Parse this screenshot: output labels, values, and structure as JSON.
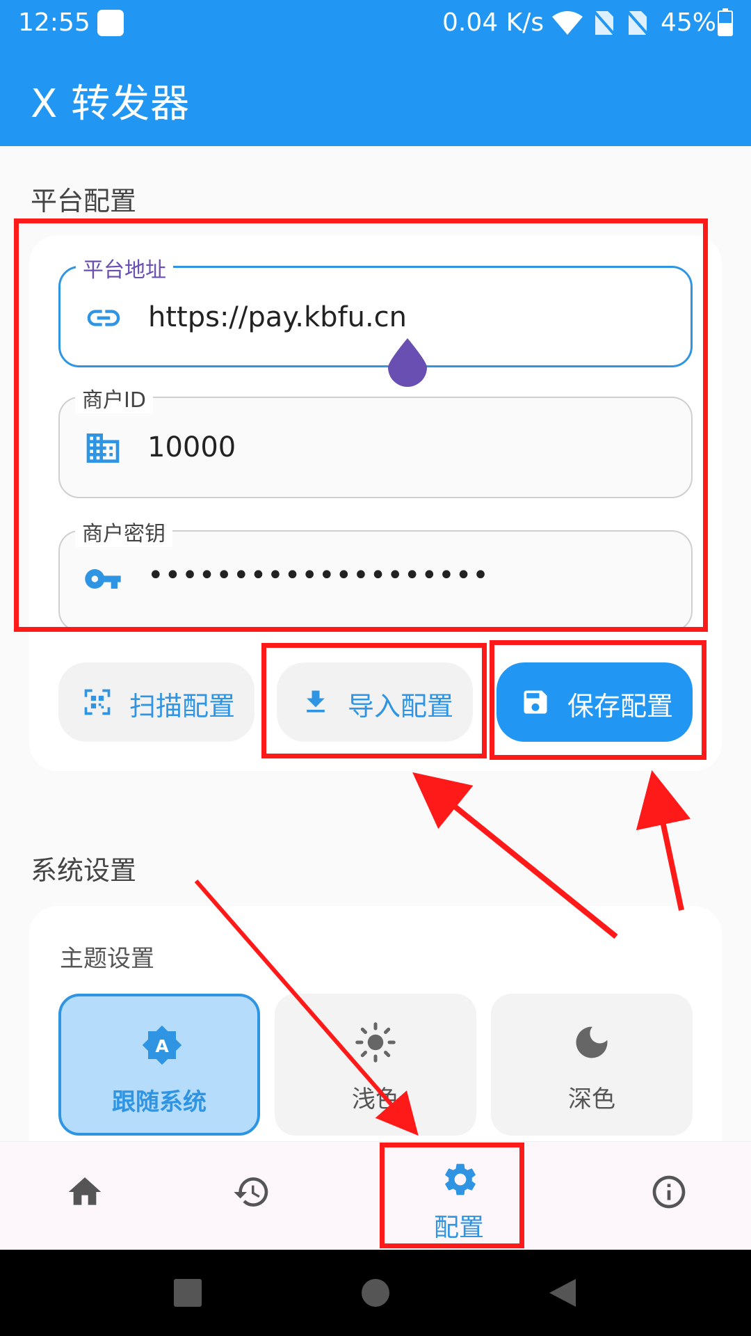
{
  "status": {
    "time": "12:55",
    "speed": "0.04 K/s",
    "battery": "45%"
  },
  "app": {
    "title": "X 转发器"
  },
  "platform": {
    "section_title": "平台配置",
    "url_label": "平台地址",
    "url_value": "https://pay.kbfu.cn",
    "merchant_label": "商户ID",
    "merchant_value": "10000",
    "key_label": "商户密钥",
    "key_value": "••••••••••••••••••••",
    "scan_label": "扫描配置",
    "import_label": "导入配置",
    "save_label": "保存配置"
  },
  "system": {
    "section_title": "系统设置",
    "theme_title": "主题设置",
    "themes": [
      {
        "label": "跟随系统",
        "icon": "auto-theme-icon",
        "active": true
      },
      {
        "label": "浅色",
        "icon": "sun-icon",
        "active": false
      },
      {
        "label": "深色",
        "icon": "moon-icon",
        "active": false
      }
    ]
  },
  "nav": {
    "items": [
      {
        "icon": "home-icon",
        "label": ""
      },
      {
        "icon": "history-icon",
        "label": ""
      },
      {
        "icon": "gear-icon",
        "label": "配置"
      },
      {
        "icon": "info-icon",
        "label": ""
      }
    ]
  },
  "colors": {
    "primary": "#2196f3",
    "annotation": "#ff1a1a",
    "selected_theme_bg": "#b5dcfb"
  }
}
